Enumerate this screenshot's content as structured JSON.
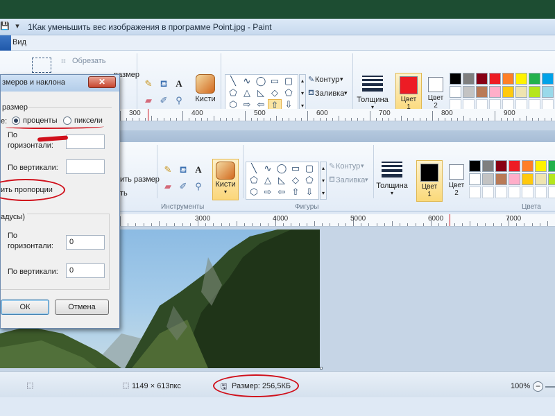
{
  "window": {
    "title": "1Как уменьшить вес изображения в программе Point.jpg - Paint",
    "tab_view": "Вид"
  },
  "ribbon": {
    "crop": "Обрезать",
    "resize_partial": "размер",
    "tools_label": "Инструменты",
    "brushes": "Кисти",
    "shapes_label": "Фигуры",
    "outline": "Контур",
    "fill": "Заливка",
    "thickness": "Толщина",
    "color1": "Цвет",
    "color1_num": "1",
    "color2": "Цвет",
    "color2_num": "2",
    "colors_label": "Цвета",
    "size_partial": "ить размер",
    "rotate_partial": "ть"
  },
  "ruler_top": [
    "300",
    "400",
    "500",
    "600",
    "700",
    "800",
    "900"
  ],
  "ruler_mid": [
    "3000",
    "4000",
    "5000",
    "6000",
    "7000"
  ],
  "palette_row1": [
    "#000000",
    "#7f7f7f",
    "#880015",
    "#ed1c24",
    "#ff7f27",
    "#fff200",
    "#22b14c",
    "#00a2e8"
  ],
  "palette_row2": [
    "#ffffff",
    "#c3c3c3",
    "#b97a57",
    "#ffaec9",
    "#ffc90e",
    "#efe4b0",
    "#b5e61d",
    "#99d9ea"
  ],
  "color1_value": "#ed1c24",
  "color1_value_mid": "#000000",
  "dialog": {
    "title": "змеров и наклона",
    "resize_section": "размер",
    "by_label": "е:",
    "percent": "проценты",
    "pixels": "пиксели",
    "horiz_label_1": "По",
    "horiz_label_2": "горизонтали:",
    "vert_label": "По вертикали:",
    "keep_ratio": "ить пропорции",
    "skew_section": "адусы)",
    "skew_h_1": "По",
    "skew_h_2": "горизонтали:",
    "skew_h_value": "0",
    "skew_v_label": "По вертикали:",
    "skew_v_value": "0",
    "ok": "ОК",
    "cancel": "Отмена"
  },
  "status": {
    "dimensions": "1149 × 613пкс",
    "size": "Размер: 256,5КБ",
    "zoom": "100%"
  }
}
